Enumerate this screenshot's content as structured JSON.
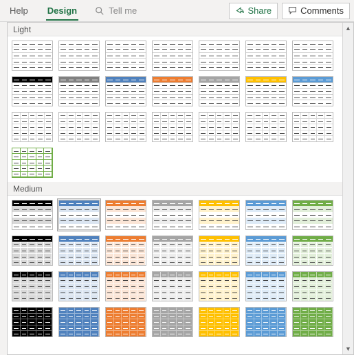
{
  "ribbon": {
    "tabs": {
      "help": "Help",
      "design": "Design"
    },
    "tellme": {
      "placeholder": "Tell me"
    },
    "share": "Share",
    "comments": "Comments"
  },
  "sections": {
    "light": "Light",
    "medium": "Medium"
  },
  "palette": {
    "neutral": {
      "c": "#000000",
      "lt": "#d9d9d9"
    },
    "gray": {
      "c": "#808080",
      "lt": "#e8e8e8"
    },
    "blue": {
      "c": "#4f81bd",
      "lt": "#dbe5f1"
    },
    "orange": {
      "c": "#ed7d31",
      "lt": "#fbe5d6"
    },
    "silver": {
      "c": "#a5a5a5",
      "lt": "#ededed"
    },
    "gold": {
      "c": "#ffc000",
      "lt": "#fff2cc"
    },
    "blue2": {
      "c": "#5b9bd5",
      "lt": "#deebf7"
    },
    "green": {
      "c": "#70ad47",
      "lt": "#e2efda"
    }
  },
  "light_rows": [
    {
      "style": "L-sep",
      "colors": [
        "neutral",
        "gray",
        "blue",
        "orange",
        "silver",
        "gold",
        "blue2"
      ]
    },
    {
      "style": "headsolid",
      "colors": [
        "neutral",
        "gray",
        "blue",
        "orange",
        "silver",
        "gold",
        "blue2"
      ]
    },
    {
      "style": "L-grid",
      "colors": [
        "green",
        "neutral",
        "blue",
        "orange",
        "silver",
        "gold",
        "blue2"
      ]
    },
    {
      "style": "L-allgrid",
      "colors": [
        "green"
      ]
    }
  ],
  "medium_rows": [
    {
      "style": "M-band",
      "colors": [
        "neutral",
        "blue",
        "orange",
        "silver",
        "gold",
        "blue2",
        "green"
      ]
    },
    {
      "style": "M-solid",
      "colors": [
        "neutral",
        "blue",
        "orange",
        "silver",
        "gold",
        "blue2",
        "green"
      ]
    },
    {
      "style": "M-fill",
      "colors": [
        "neutral",
        "blue",
        "orange",
        "silver",
        "gold",
        "blue2",
        "green"
      ]
    },
    {
      "style": "M-dark",
      "colors": [
        "neutral",
        "blue",
        "orange",
        "silver",
        "gold",
        "blue2",
        "green"
      ]
    }
  ],
  "selected": {
    "section": "medium",
    "row": 0,
    "col": 1
  }
}
